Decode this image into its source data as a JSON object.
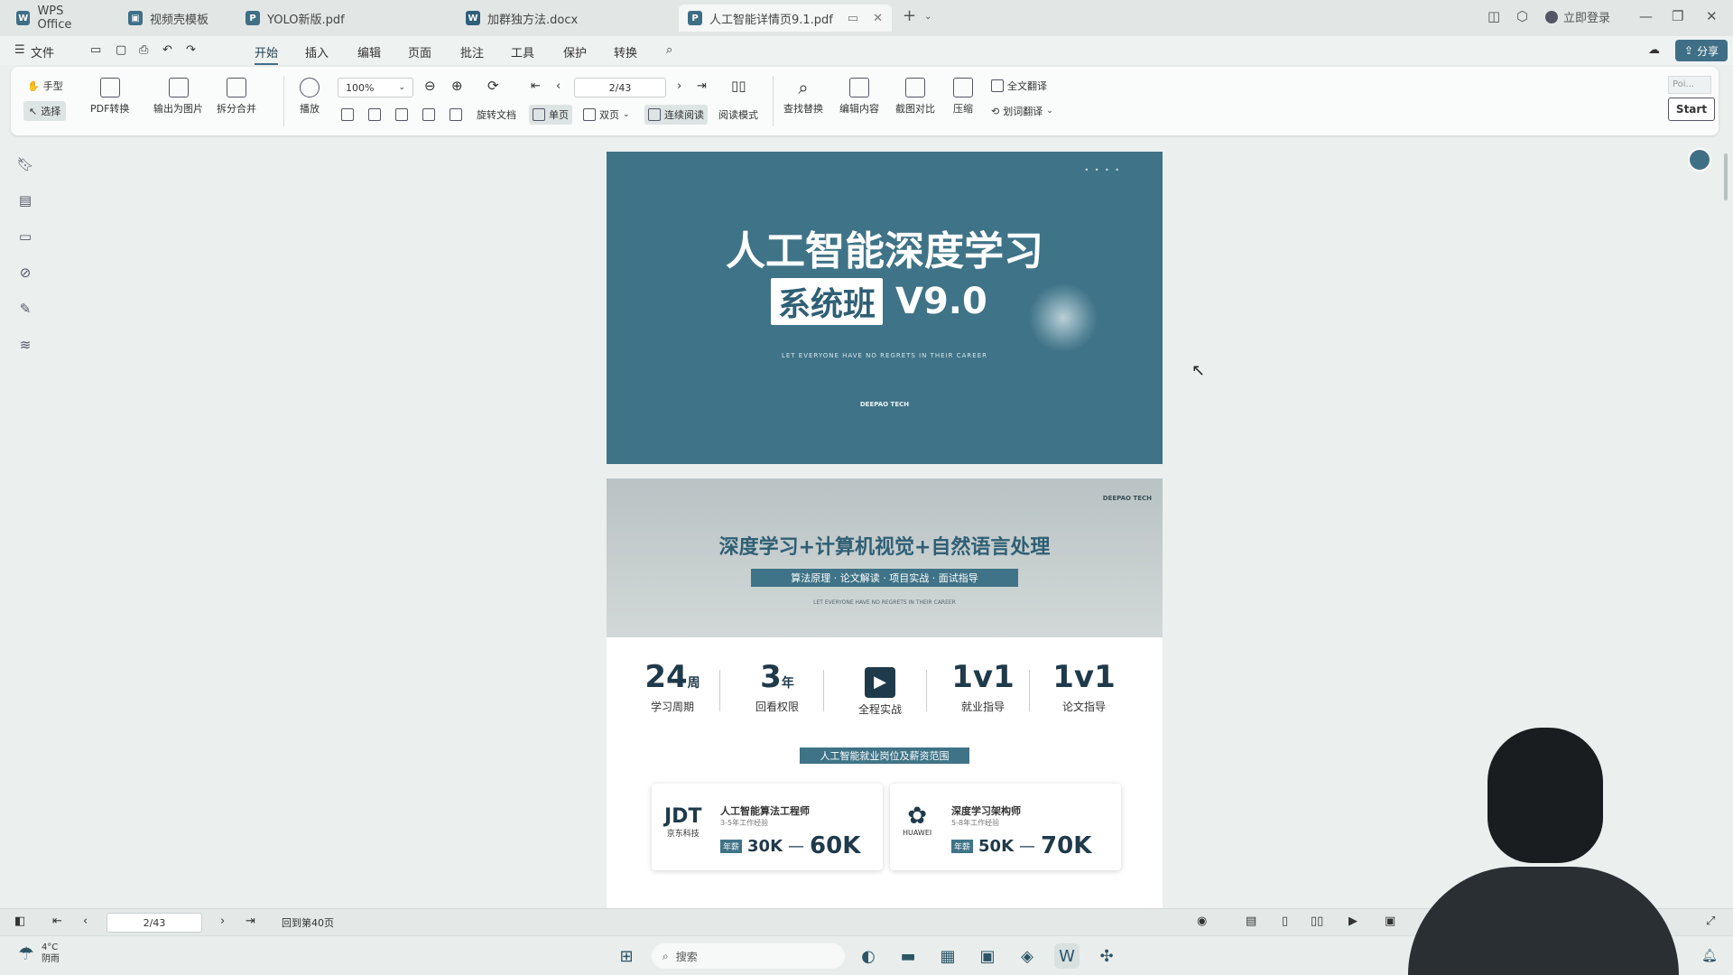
{
  "tabs": [
    {
      "label": "WPS Office",
      "icon": "wps-icon"
    },
    {
      "label": "视频壳模板",
      "icon": "video-template-icon"
    },
    {
      "label": "YOLO新版.pdf",
      "icon": "pdf-icon"
    },
    {
      "label": "加群独方法.docx",
      "icon": "word-icon"
    },
    {
      "label": "人工智能详情页9.1.pdf",
      "icon": "pdf-icon"
    }
  ],
  "login_label": "立即登录",
  "menu": [
    "文件",
    "开始",
    "插入",
    "编辑",
    "页面",
    "批注",
    "工具",
    "保护",
    "转换"
  ],
  "share_label": "分享",
  "toolbar": {
    "hand": "手型",
    "select": "选择",
    "pdf_convert": "PDF转换",
    "export_image": "输出为图片",
    "split_merge": "拆分合并",
    "play": "播放",
    "zoom": "100%",
    "page_value": "2/43",
    "rotate": "旋转文档",
    "single": "单页",
    "double": "双页",
    "continuous": "连续阅读",
    "read_mode": "阅读模式",
    "find_replace": "查找替换",
    "edit_content": "编辑内容",
    "compare": "截图对比",
    "compress": "压缩",
    "full_translate": "全文翻译",
    "word_translate": "划词翻译",
    "start": "Start",
    "poi": "Poi..."
  },
  "doc": {
    "page1": {
      "title": "人工智能深度学习",
      "badge": "系统班",
      "version": "V9.0",
      "tagline": "LET EVERYONE HAVE NO REGRETS IN THEIR CAREER",
      "brand": "DEEPAO TECH"
    },
    "page2": {
      "corner": "DEEPAO TECH",
      "headline": "深度学习+计算机视觉+自然语言处理",
      "bar": "算法原理 · 论文解读 · 项目实战 · 面试指导",
      "small": "LET EVERYONE HAVE NO REGRETS IN THEIR CAREER",
      "stats": [
        {
          "big": "24",
          "unit": "周",
          "label": "学习周期"
        },
        {
          "big": "3",
          "unit": "年",
          "label": "回看权限"
        },
        {
          "big": "▶",
          "unit": "",
          "label": "全程实战"
        },
        {
          "big": "1v1",
          "unit": "",
          "label": "就业指导"
        },
        {
          "big": "1v1",
          "unit": "",
          "label": "论文指导"
        }
      ],
      "section": "人工智能就业岗位及薪资范围",
      "jobs": [
        {
          "logo": "JDT",
          "logo_sub": "京东科技",
          "title": "人工智能算法工程师",
          "desc": "3-5年工作经验",
          "tag": "年薪",
          "low": "30K",
          "high": "60K"
        },
        {
          "logo": "HUAWEI",
          "logo_sub": "HUAWEI",
          "title": "深度学习架构师",
          "desc": "5-8年工作经验",
          "tag": "年薪",
          "low": "50K",
          "high": "70K"
        }
      ]
    }
  },
  "statusbar": {
    "page": "2/43",
    "goto": "回到第40页"
  },
  "taskbar": {
    "weather": "4°C",
    "weather_desc": "阴雨",
    "search": "搜索"
  }
}
